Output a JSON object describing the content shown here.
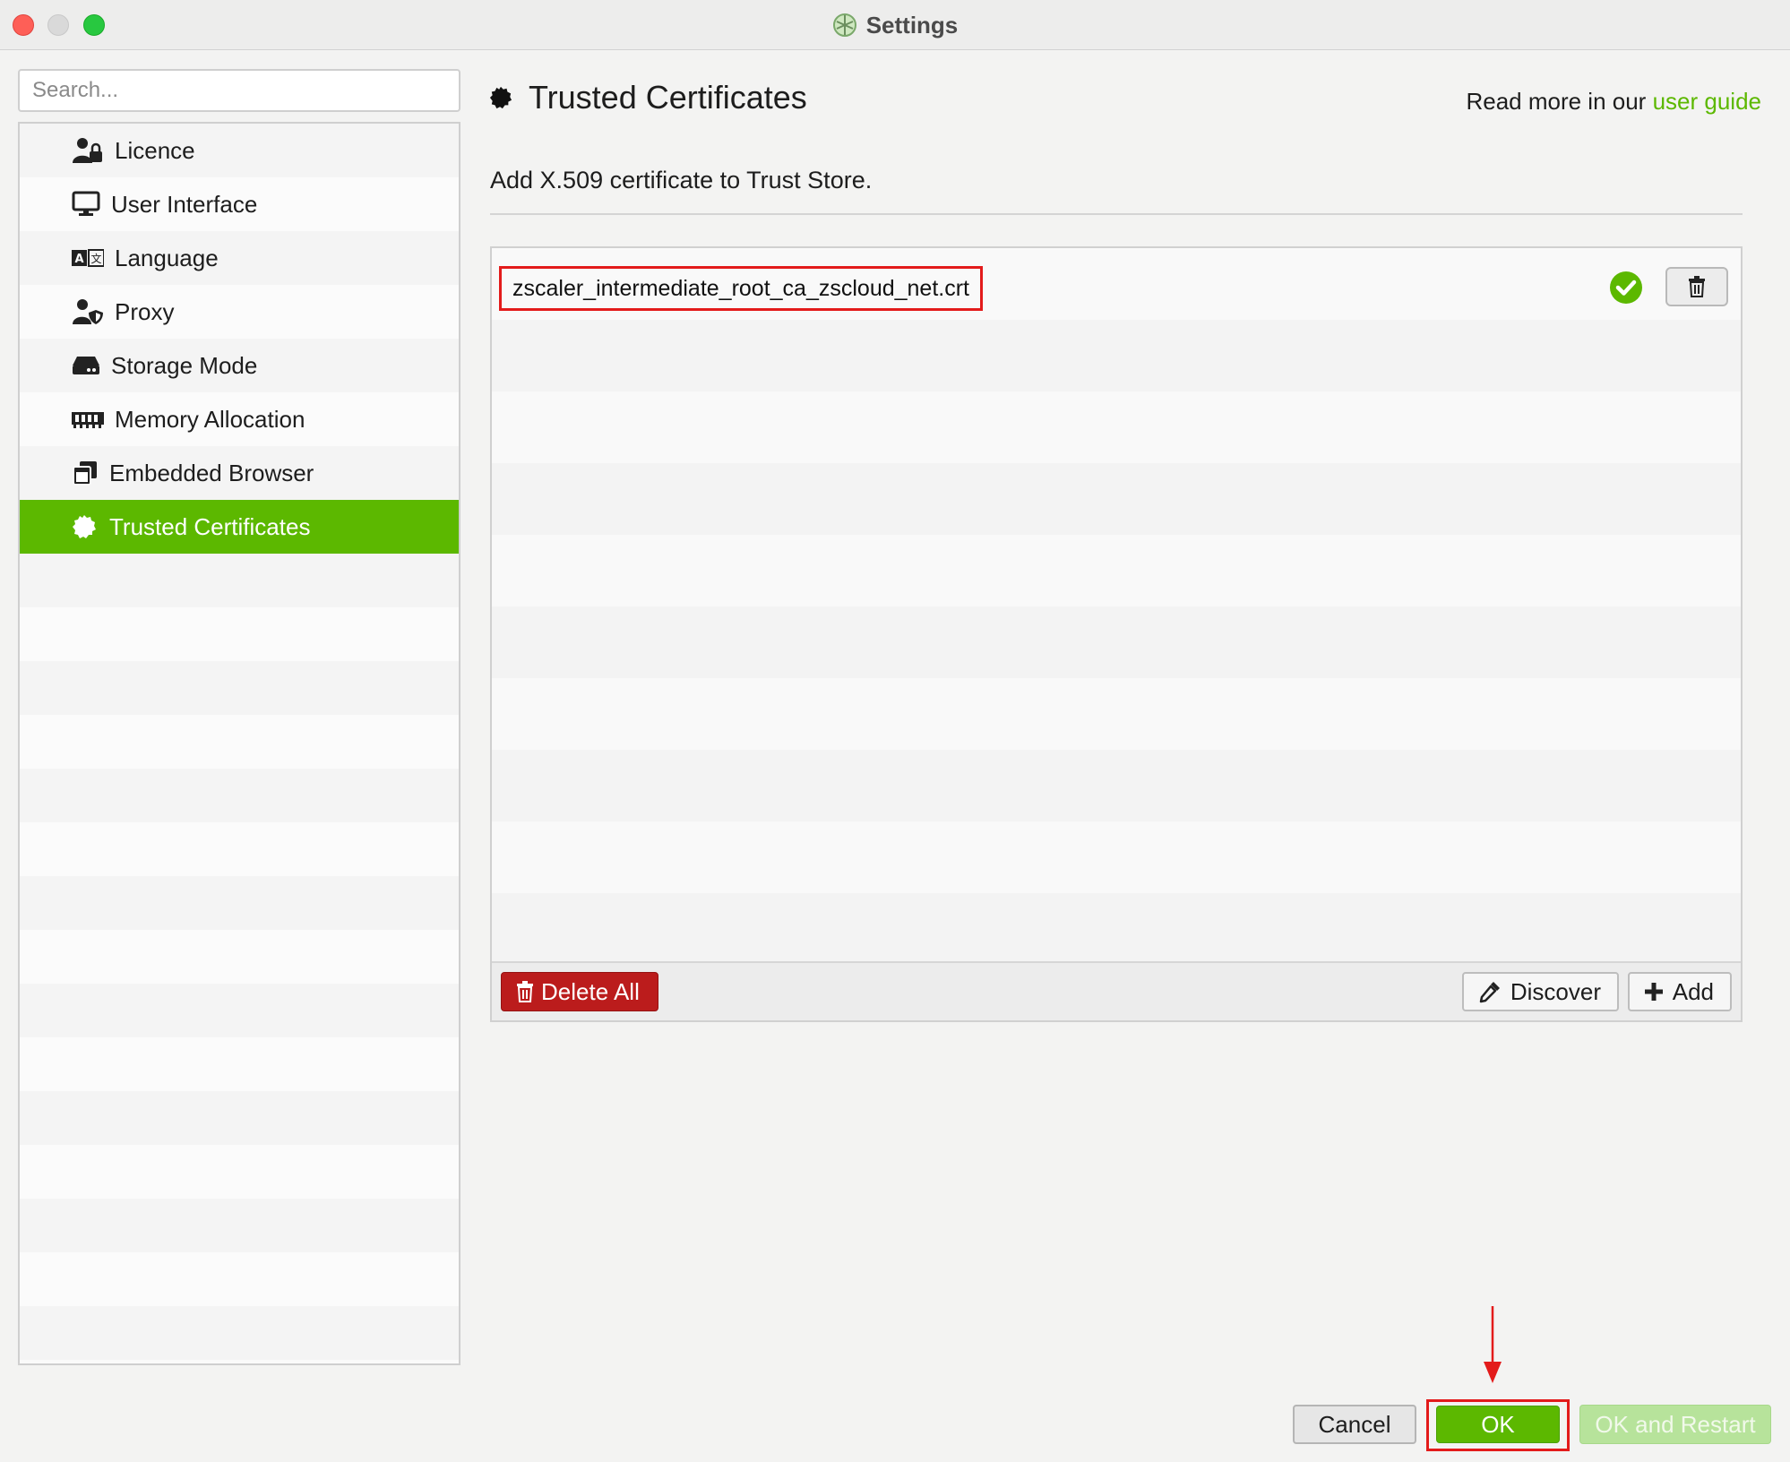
{
  "window": {
    "title": "Settings"
  },
  "search": {
    "placeholder": "Search..."
  },
  "sidebar": {
    "items": [
      {
        "label": "Licence",
        "icon": "user-lock-icon"
      },
      {
        "label": "User Interface",
        "icon": "monitor-icon"
      },
      {
        "label": "Language",
        "icon": "language-icon"
      },
      {
        "label": "Proxy",
        "icon": "user-shield-icon"
      },
      {
        "label": "Storage Mode",
        "icon": "hard-drive-icon"
      },
      {
        "label": "Memory Allocation",
        "icon": "memory-icon"
      },
      {
        "label": "Embedded Browser",
        "icon": "browser-windows-icon"
      },
      {
        "label": "Trusted Certificates",
        "icon": "certificate-badge-icon",
        "selected": true
      }
    ]
  },
  "main": {
    "title": "Trusted Certificates",
    "read_more_prefix": "Read more in our",
    "read_more_link": "user guide",
    "subtitle": "Add X.509 certificate to Trust Store.",
    "certificates": [
      {
        "name": "zscaler_intermediate_root_ca_zscloud_net.crt",
        "status": "valid"
      }
    ],
    "toolbar": {
      "delete_all": "Delete All",
      "discover": "Discover",
      "add": "Add"
    }
  },
  "footer": {
    "cancel": "Cancel",
    "ok": "OK",
    "ok_restart": "OK and Restart"
  },
  "colors": {
    "accent": "#5cb800",
    "danger": "#bb1c1c",
    "highlight": "#e31b1b"
  }
}
